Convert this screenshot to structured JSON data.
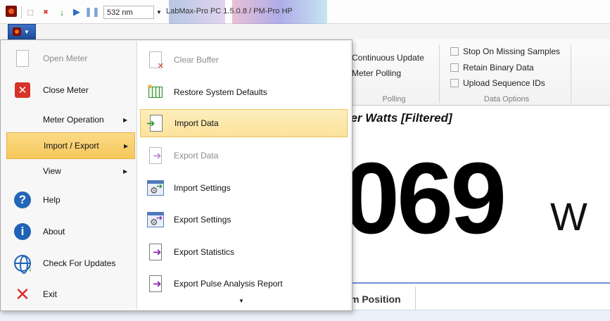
{
  "toolbar": {
    "wavelength": "532 nm",
    "title": "LabMax-Pro PC 1.5.0.8  /  PM-Pro HP"
  },
  "ribbon": {
    "polling": {
      "items": [
        "Continuous Update",
        "Meter Polling"
      ],
      "label": "Polling"
    },
    "data_options": {
      "items": [
        "Stop On Missing Samples",
        "Retain Binary Data",
        "Upload Sequence IDs"
      ],
      "label": "Data Options"
    }
  },
  "main": {
    "measurement_title": "ver Watts [Filtered]",
    "value": "069",
    "unit": "W",
    "tab_label": "m Position"
  },
  "app_menu": {
    "left_items": [
      {
        "label": "Open Meter",
        "icon": "open-document-icon"
      },
      {
        "label": "Close Meter",
        "icon": "close-red-icon"
      },
      {
        "label": "Meter Operation",
        "submenu": true
      },
      {
        "label": "Import / Export",
        "submenu": true
      },
      {
        "label": "View",
        "submenu": true
      },
      {
        "label": "Help",
        "icon": "help-icon"
      },
      {
        "label": "About",
        "icon": "info-icon"
      },
      {
        "label": "Check For Updates",
        "icon": "globe-download-icon"
      },
      {
        "label": "Exit",
        "icon": "exit-x-icon"
      }
    ],
    "right_items": [
      {
        "label": "Clear Buffer",
        "icon": "clear-buffer-icon"
      },
      {
        "label": "Restore System Defaults",
        "icon": "restore-defaults-icon"
      },
      {
        "label": "Import Data",
        "icon": "import-data-icon"
      },
      {
        "label": "Export Data",
        "icon": "export-data-icon"
      },
      {
        "label": "Import Settings",
        "icon": "import-settings-icon"
      },
      {
        "label": "Export Settings",
        "icon": "export-settings-icon"
      },
      {
        "label": "Export Statistics",
        "icon": "export-statistics-icon"
      },
      {
        "label": "Export Pulse Analysis Report",
        "icon": "export-report-icon"
      }
    ]
  },
  "colors": {
    "menu_selected": "#f6c65a",
    "item_highlight": "#fbe39b",
    "accent_blue": "#1e63b6",
    "close_red": "#d8332b"
  }
}
